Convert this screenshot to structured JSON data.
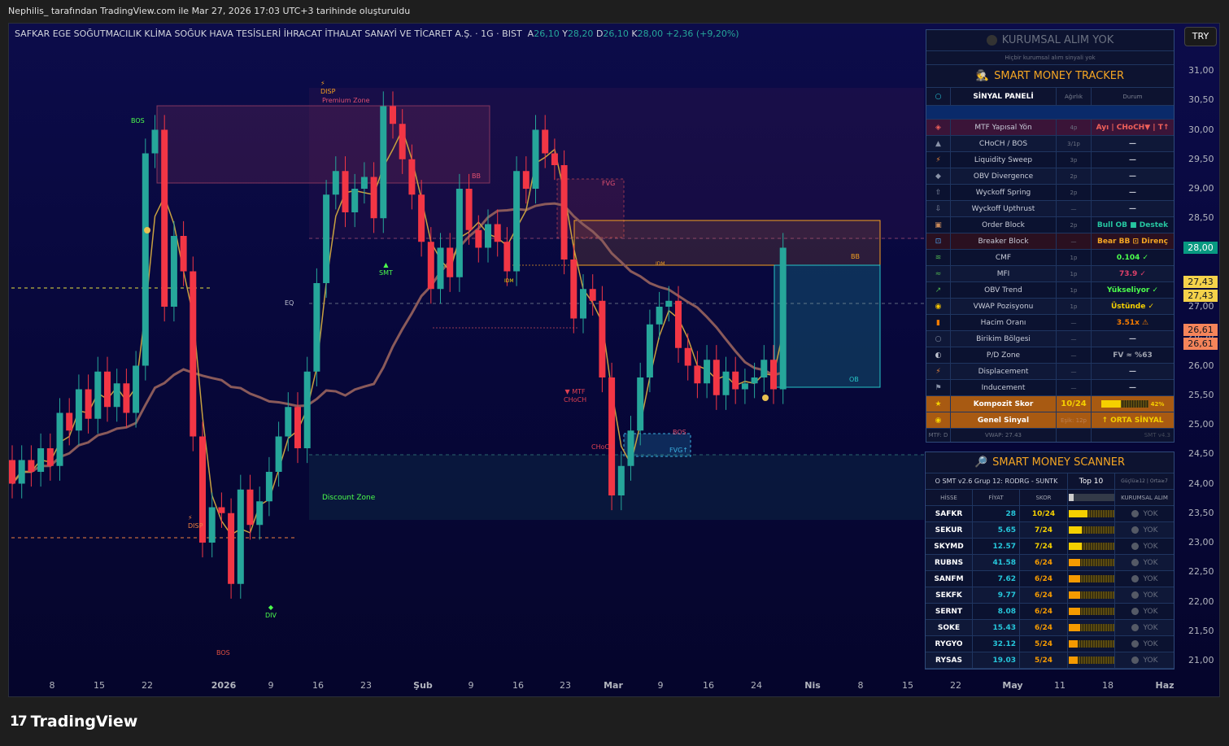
{
  "header": {
    "created_by": "Nephilis_ tarafından TradingView.com ile Mar 27, 2026 17:03 UTC+3 tarihinde oluşturuldu"
  },
  "legend": {
    "symbol": "SAFKAR EGE SOĞUTMACILIK KLİMA SOĞUK HAVA TESİSLERİ İHRACAT İTHALAT SANAYİ VE TİCARET A.Ş. · 1G · BIST",
    "o_label": "A",
    "o": "26,10",
    "h_label": "Y",
    "h": "28,20",
    "l_label": "D",
    "l": "26,10",
    "c_label": "K",
    "c": "28,00",
    "change": "+2,36 (+9,20%)"
  },
  "currency": "TRY",
  "price_badges": {
    "last": "28,00",
    "vwap_a": "27,43",
    "vwap_b": "27,43",
    "level_a": "26,61",
    "level_b": "26,61"
  },
  "colors": {
    "up": "#26a69a",
    "down": "#f23645",
    "accent": "#f5a623"
  },
  "chart_data": {
    "type": "candlestick",
    "title": "SAFKAR · 1G · BIST",
    "ylim": [
      20.8,
      31.4
    ],
    "yticks": [
      "31,00",
      "30,50",
      "30,00",
      "29,50",
      "29,00",
      "28,50",
      "28,00",
      "27,50",
      "27,00",
      "26,50",
      "26,00",
      "25,50",
      "25,00",
      "24,50",
      "24,00",
      "23,50",
      "23,00",
      "22,50",
      "22,00",
      "21,50",
      "21,00"
    ],
    "xticks": [
      "8",
      "15",
      "22",
      "2026",
      "9",
      "16",
      "23",
      "Şub",
      "9",
      "16",
      "23",
      "Mar",
      "9",
      "16",
      "24",
      "Nis",
      "8",
      "15",
      "22",
      "May",
      "11",
      "18",
      "Haz"
    ],
    "close": [
      24.0,
      24.4,
      24.2,
      24.6,
      24.3,
      25.2,
      24.9,
      25.6,
      25.1,
      25.9,
      25.3,
      25.7,
      25.2,
      26.0,
      29.6,
      30.0,
      27.0,
      28.2,
      27.6,
      24.8,
      23.0,
      23.6,
      23.5,
      22.3,
      23.9,
      23.3,
      23.7,
      24.2,
      24.8,
      25.3,
      24.6,
      25.9,
      27.4,
      28.9,
      29.3,
      28.6,
      29.0,
      29.2,
      28.5,
      30.4,
      30.1,
      29.5,
      28.9,
      28.1,
      27.3,
      28.0,
      27.5,
      29.0,
      28.3,
      28.0,
      28.4,
      28.1,
      27.6,
      29.3,
      29.0,
      30.0,
      29.6,
      29.4,
      27.8,
      26.8,
      27.3,
      27.1,
      25.8,
      23.8,
      24.3,
      24.9,
      25.8,
      26.7,
      27.0,
      27.1,
      26.3,
      26.0,
      25.7,
      26.1,
      25.5,
      25.9,
      25.6,
      25.7,
      25.8,
      26.1,
      25.6,
      28.0
    ],
    "first_open": 24.4,
    "annotations": {
      "bos1": "BOS",
      "disp1": "⚡\nDISP",
      "premium": "Premium Zone",
      "bb1": "BB",
      "fvg1": "FVG",
      "smt": "▲\nSMT",
      "idm1": "IDM",
      "eq": "EQ",
      "idm2": "IDM",
      "mtf_choch": "▼ MTF\nCHoCH",
      "choch": "CHoCH",
      "bos2": "BOS",
      "fvg2": "FVG↑",
      "discount": "Discount Zone",
      "disp2": "⚡\nDISP",
      "div": "◆\nDIV",
      "bos3": "BOS",
      "ob": "OB",
      "bb2": "BB"
    }
  },
  "signal_panel": {
    "status_title": "KURUMSAL ALIM YOK",
    "status_sub": "Hiçbir kurumsal alım sinyali yok",
    "title": "SMART MONEY TRACKER",
    "headers": [
      "SİNYAL PANELİ",
      "Ağırlık",
      "Durum"
    ],
    "rows": [
      {
        "icon": "◈",
        "name": "MTF Yapısal Yön",
        "w": "4p",
        "s": "Ayı | CHoCH▼ | T↑",
        "ic": "#f0605a",
        "sc": "#f0605a",
        "hl": true
      },
      {
        "icon": "▲",
        "name": "CHoCH / BOS",
        "w": "3/1p",
        "s": "—",
        "ic": "#8a93a8",
        "sc": "#c0c4d0"
      },
      {
        "icon": "⚡",
        "name": "Liquidity Sweep",
        "w": "3p",
        "s": "—",
        "ic": "#f08a3c",
        "sc": "#c0c4d0"
      },
      {
        "icon": "◆",
        "name": "OBV Divergence",
        "w": "2p",
        "s": "—",
        "ic": "#8a93a8",
        "sc": "#c0c4d0"
      },
      {
        "icon": "⇧",
        "name": "Wyckoff Spring",
        "w": "2p",
        "s": "—",
        "ic": "#8a93a8",
        "sc": "#c0c4d0"
      },
      {
        "icon": "⇩",
        "name": "Wyckoff Upthrust",
        "w": "—",
        "s": "—",
        "ic": "#8a93a8",
        "sc": "#c0c4d0"
      },
      {
        "icon": "▣",
        "name": "Order Block",
        "w": "2p",
        "s": "Bull OB ■ Destek",
        "ic": "#c8895a",
        "sc": "#26c6a0"
      },
      {
        "icon": "⊡",
        "name": "Breaker Block",
        "w": "—",
        "s": "Bear BB ⊡ Direnç",
        "ic": "#4aa3f0",
        "sc": "#f5a623",
        "hl2": true
      },
      {
        "icon": "≋",
        "name": "CMF",
        "w": "1p",
        "s": "0.104 ✓",
        "ic": "#4caf50",
        "sc": "#4cff4c"
      },
      {
        "icon": "≈",
        "name": "MFI",
        "w": "1p",
        "s": "73.9 ✓",
        "ic": "#4caf50",
        "sc": "#e0406a"
      },
      {
        "icon": "↗",
        "name": "OBV Trend",
        "w": "1p",
        "s": "Yükseliyor ✓",
        "ic": "#4caf50",
        "sc": "#4cff4c"
      },
      {
        "icon": "◉",
        "name": "VWAP Pozisyonu",
        "w": "1p",
        "s": "Üstünde ✓",
        "ic": "#f5c400",
        "sc": "#f5d000"
      },
      {
        "icon": "▮",
        "name": "Hacim Oranı",
        "w": "—",
        "s": "3.51x ⚠",
        "ic": "#f57c00",
        "sc": "#f57c00"
      },
      {
        "icon": "○",
        "name": "Birikim Bölgesi",
        "w": "—",
        "s": "—",
        "ic": "#8a93a8",
        "sc": "#c0c4d0"
      },
      {
        "icon": "◐",
        "name": "P/D Zone",
        "w": "—",
        "s": "FV ≈ %63",
        "ic": "#c0c4d0",
        "sc": "#a0a4b0"
      },
      {
        "icon": "⚡",
        "name": "Displacement",
        "w": "—",
        "s": "—",
        "ic": "#f08a3c",
        "sc": "#c0c4d0"
      },
      {
        "icon": "⚑",
        "name": "Inducement",
        "w": "—",
        "s": "—",
        "ic": "#8a93a8",
        "sc": "#c0c4d0"
      }
    ],
    "composite": {
      "icon": "★",
      "name": "Kompozit Skor",
      "value": "10/24",
      "percent": 42,
      "percent_label": "42%"
    },
    "general": {
      "icon": "◉",
      "name": "Genel Sinyal",
      "threshold": "Eşik: 12p",
      "signal": "↑ ORTA SİNYAL"
    },
    "footer": {
      "mtf": "MTF: D",
      "vwap": "VWAP: 27.43",
      "version": "SMT v4.3"
    }
  },
  "scanner": {
    "title": "SMART MONEY SCANNER",
    "group": "O SMT v2.6 Grup 12: RODRG - SUNTK",
    "top": "Top 10",
    "legend": "Güçlü≥12 | Orta≥7",
    "headers": [
      "HİSSE",
      "FİYAT",
      "SKOR",
      "KURUMSAL ALIM"
    ],
    "rows": [
      {
        "t": "SAFKR",
        "p": "28",
        "s": "10/24",
        "f": 42,
        "k": "YOK",
        "c": "#f5d000"
      },
      {
        "t": "SEKUR",
        "p": "5.65",
        "s": "7/24",
        "f": 29,
        "k": "YOK",
        "c": "#f5d000"
      },
      {
        "t": "SKYMD",
        "p": "12.57",
        "s": "7/24",
        "f": 29,
        "k": "YOK",
        "c": "#f5d000"
      },
      {
        "t": "RUBNS",
        "p": "41.58",
        "s": "6/24",
        "f": 25,
        "k": "YOK",
        "c": "#f59a00"
      },
      {
        "t": "SANFM",
        "p": "7.62",
        "s": "6/24",
        "f": 25,
        "k": "YOK",
        "c": "#f59a00"
      },
      {
        "t": "SEKFK",
        "p": "9.77",
        "s": "6/24",
        "f": 25,
        "k": "YOK",
        "c": "#f59a00"
      },
      {
        "t": "SERNT",
        "p": "8.08",
        "s": "6/24",
        "f": 25,
        "k": "YOK",
        "c": "#f59a00"
      },
      {
        "t": "SOKE",
        "p": "15.43",
        "s": "6/24",
        "f": 25,
        "k": "YOK",
        "c": "#f59a00"
      },
      {
        "t": "RYGYO",
        "p": "32.12",
        "s": "5/24",
        "f": 21,
        "k": "YOK",
        "c": "#f59a00"
      },
      {
        "t": "RYSAS",
        "p": "19.03",
        "s": "5/24",
        "f": 21,
        "k": "YOK",
        "c": "#f59a00"
      }
    ]
  },
  "footer": {
    "brand": "TradingView"
  }
}
